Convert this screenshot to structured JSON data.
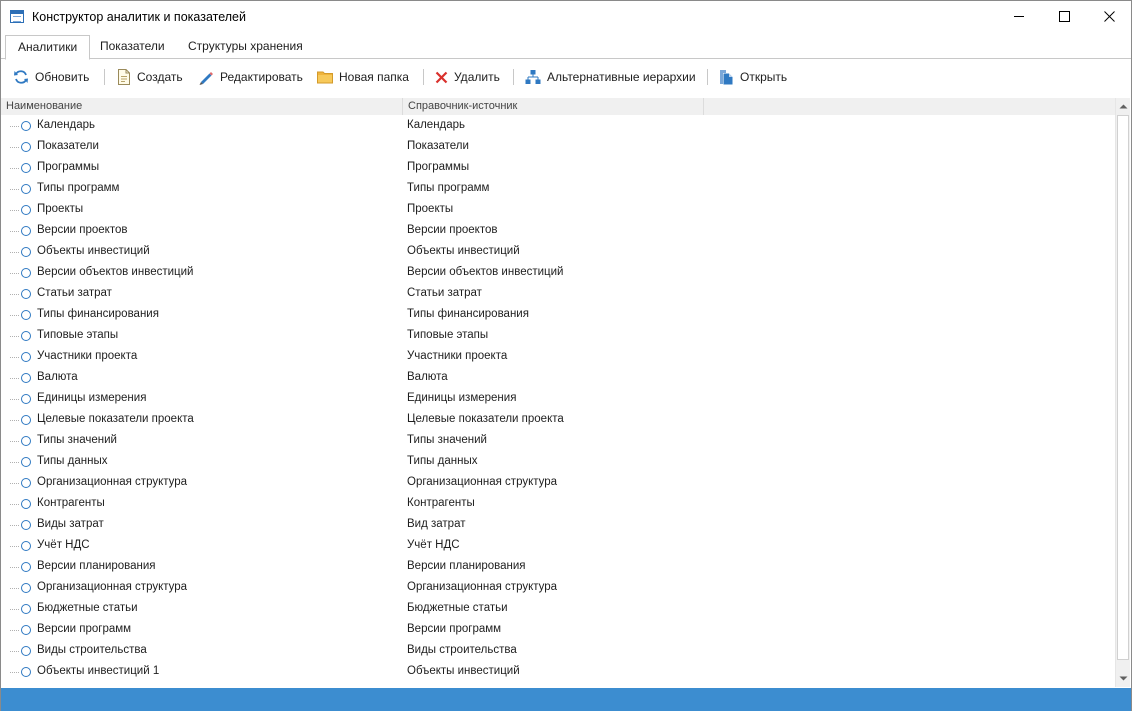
{
  "window": {
    "title": "Конструктор аналитик и показателей"
  },
  "tabs": [
    {
      "label": "Аналитики",
      "active": true
    },
    {
      "label": "Показатели",
      "active": false
    },
    {
      "label": "Структуры хранения",
      "active": false
    }
  ],
  "toolbar": {
    "refresh": "Обновить",
    "create": "Создать",
    "edit": "Редактировать",
    "new_folder": "Новая папка",
    "delete": "Удалить",
    "alt_hierarchies": "Альтернативные иерархии",
    "open": "Открыть"
  },
  "grid": {
    "columns": [
      "Наименование",
      "Справочник-источник"
    ],
    "rows": [
      {
        "name": "Календарь",
        "source": "Календарь"
      },
      {
        "name": "Показатели",
        "source": "Показатели"
      },
      {
        "name": "Программы",
        "source": "Программы"
      },
      {
        "name": "Типы программ",
        "source": "Типы программ"
      },
      {
        "name": "Проекты",
        "source": "Проекты"
      },
      {
        "name": "Версии проектов",
        "source": "Версии проектов"
      },
      {
        "name": "Объекты инвестиций",
        "source": "Объекты инвестиций"
      },
      {
        "name": "Версии объектов инвестиций",
        "source": "Версии объектов инвестиций"
      },
      {
        "name": "Статьи затрат",
        "source": "Статьи затрат"
      },
      {
        "name": "Типы финансирования",
        "source": "Типы финансирования"
      },
      {
        "name": "Типовые этапы",
        "source": "Типовые этапы"
      },
      {
        "name": "Участники проекта",
        "source": "Участники проекта"
      },
      {
        "name": "Валюта",
        "source": "Валюта"
      },
      {
        "name": "Единицы измерения",
        "source": "Единицы измерения"
      },
      {
        "name": "Целевые показатели проекта",
        "source": "Целевые показатели проекта"
      },
      {
        "name": "Типы значений",
        "source": "Типы значений"
      },
      {
        "name": "Типы данных",
        "source": "Типы данных"
      },
      {
        "name": "Организационная структура",
        "source": "Организационная структура"
      },
      {
        "name": "Контрагенты",
        "source": "Контрагенты"
      },
      {
        "name": "Виды затрат",
        "source": "Вид затрат"
      },
      {
        "name": "Учёт НДС",
        "source": "Учёт НДС"
      },
      {
        "name": "Версии планирования",
        "source": "Версии планирования"
      },
      {
        "name": "Организационная структура",
        "source": "Организационная структура"
      },
      {
        "name": "Бюджетные статьи",
        "source": "Бюджетные статьи"
      },
      {
        "name": "Версии программ",
        "source": "Версии программ"
      },
      {
        "name": "Виды строительства",
        "source": "Виды строительства"
      },
      {
        "name": "Объекты инвестиций 1",
        "source": "Объекты инвестиций"
      }
    ]
  },
  "colors": {
    "accent": "#2f79c2",
    "statusbar": "#3c8dd0",
    "delete_icon": "#d9302c",
    "folder_icon": "#f0b43c"
  }
}
